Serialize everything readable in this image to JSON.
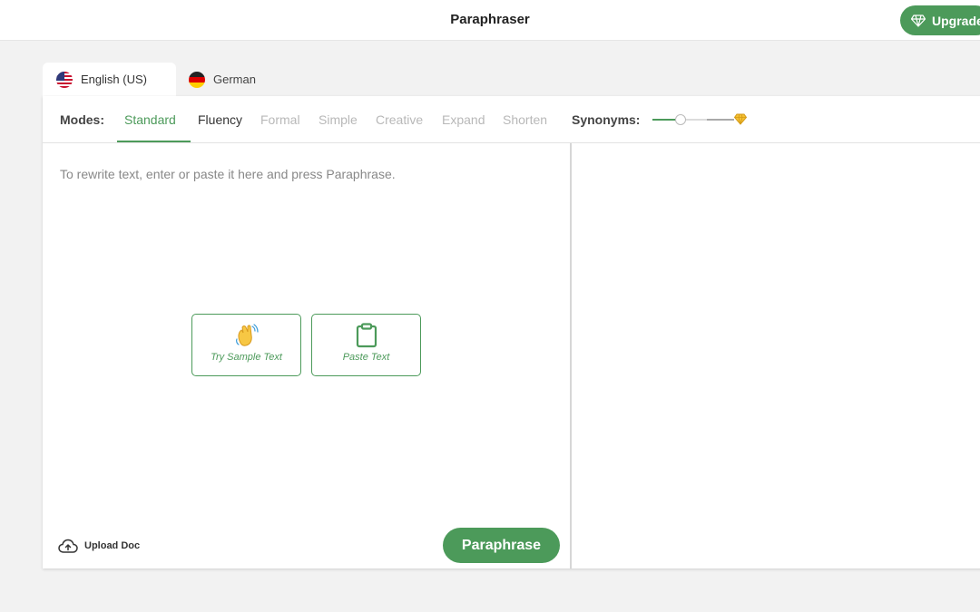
{
  "header": {
    "title": "Paraphraser",
    "upgrade_label": "Upgrade"
  },
  "language_tabs": [
    {
      "label": "English (US)",
      "active": true,
      "flag": "us-flag-icon"
    },
    {
      "label": "German",
      "active": false,
      "flag": "germany-flag-icon"
    }
  ],
  "modes": {
    "label": "Modes:",
    "items": [
      {
        "label": "Standard",
        "state": "active"
      },
      {
        "label": "Fluency",
        "state": "enabled"
      },
      {
        "label": "Formal",
        "state": "disabled"
      },
      {
        "label": "Simple",
        "state": "disabled"
      },
      {
        "label": "Creative",
        "state": "disabled"
      },
      {
        "label": "Expand",
        "state": "disabled"
      },
      {
        "label": "Shorten",
        "state": "disabled"
      }
    ]
  },
  "synonyms": {
    "label": "Synonyms:",
    "level": 0.3,
    "premium_icon": "diamond-icon"
  },
  "editor": {
    "placeholder": "To rewrite text, enter or paste it here and press Paraphrase.",
    "try_sample_label": "Try Sample Text",
    "paste_label": "Paste Text",
    "upload_label": "Upload Doc",
    "paraphrase_label": "Paraphrase"
  },
  "colors": {
    "accent": "#4c9a5a",
    "disabled": "#b8b8b8",
    "premium": "#f4c033"
  }
}
